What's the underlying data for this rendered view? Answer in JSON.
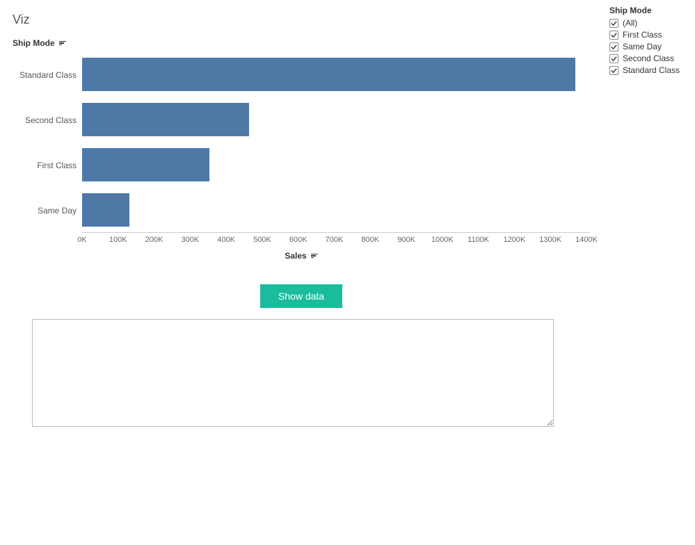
{
  "title": "Viz",
  "y_axis_label": "Ship Mode",
  "x_axis_label": "Sales",
  "button_label": "Show data",
  "filter": {
    "title": "Ship Mode",
    "items": [
      {
        "label": "(All)",
        "checked": true
      },
      {
        "label": "First Class",
        "checked": true
      },
      {
        "label": "Same Day",
        "checked": true
      },
      {
        "label": "Second Class",
        "checked": true
      },
      {
        "label": "Standard Class",
        "checked": true
      }
    ]
  },
  "x_ticks": [
    "0K",
    "100K",
    "200K",
    "300K",
    "400K",
    "500K",
    "600K",
    "700K",
    "800K",
    "900K",
    "1000K",
    "1100K",
    "1200K",
    "1300K",
    "1400K"
  ],
  "chart_data": {
    "type": "bar",
    "orientation": "horizontal",
    "title": "Viz",
    "xlabel": "Sales",
    "ylabel": "Ship Mode",
    "xlim": [
      0,
      1400000
    ],
    "categories": [
      "Standard Class",
      "Second Class",
      "First Class",
      "Same Day"
    ],
    "values": [
      1360000,
      460000,
      350000,
      130000
    ],
    "bar_color": "#4e79a7",
    "sort": "descending"
  }
}
